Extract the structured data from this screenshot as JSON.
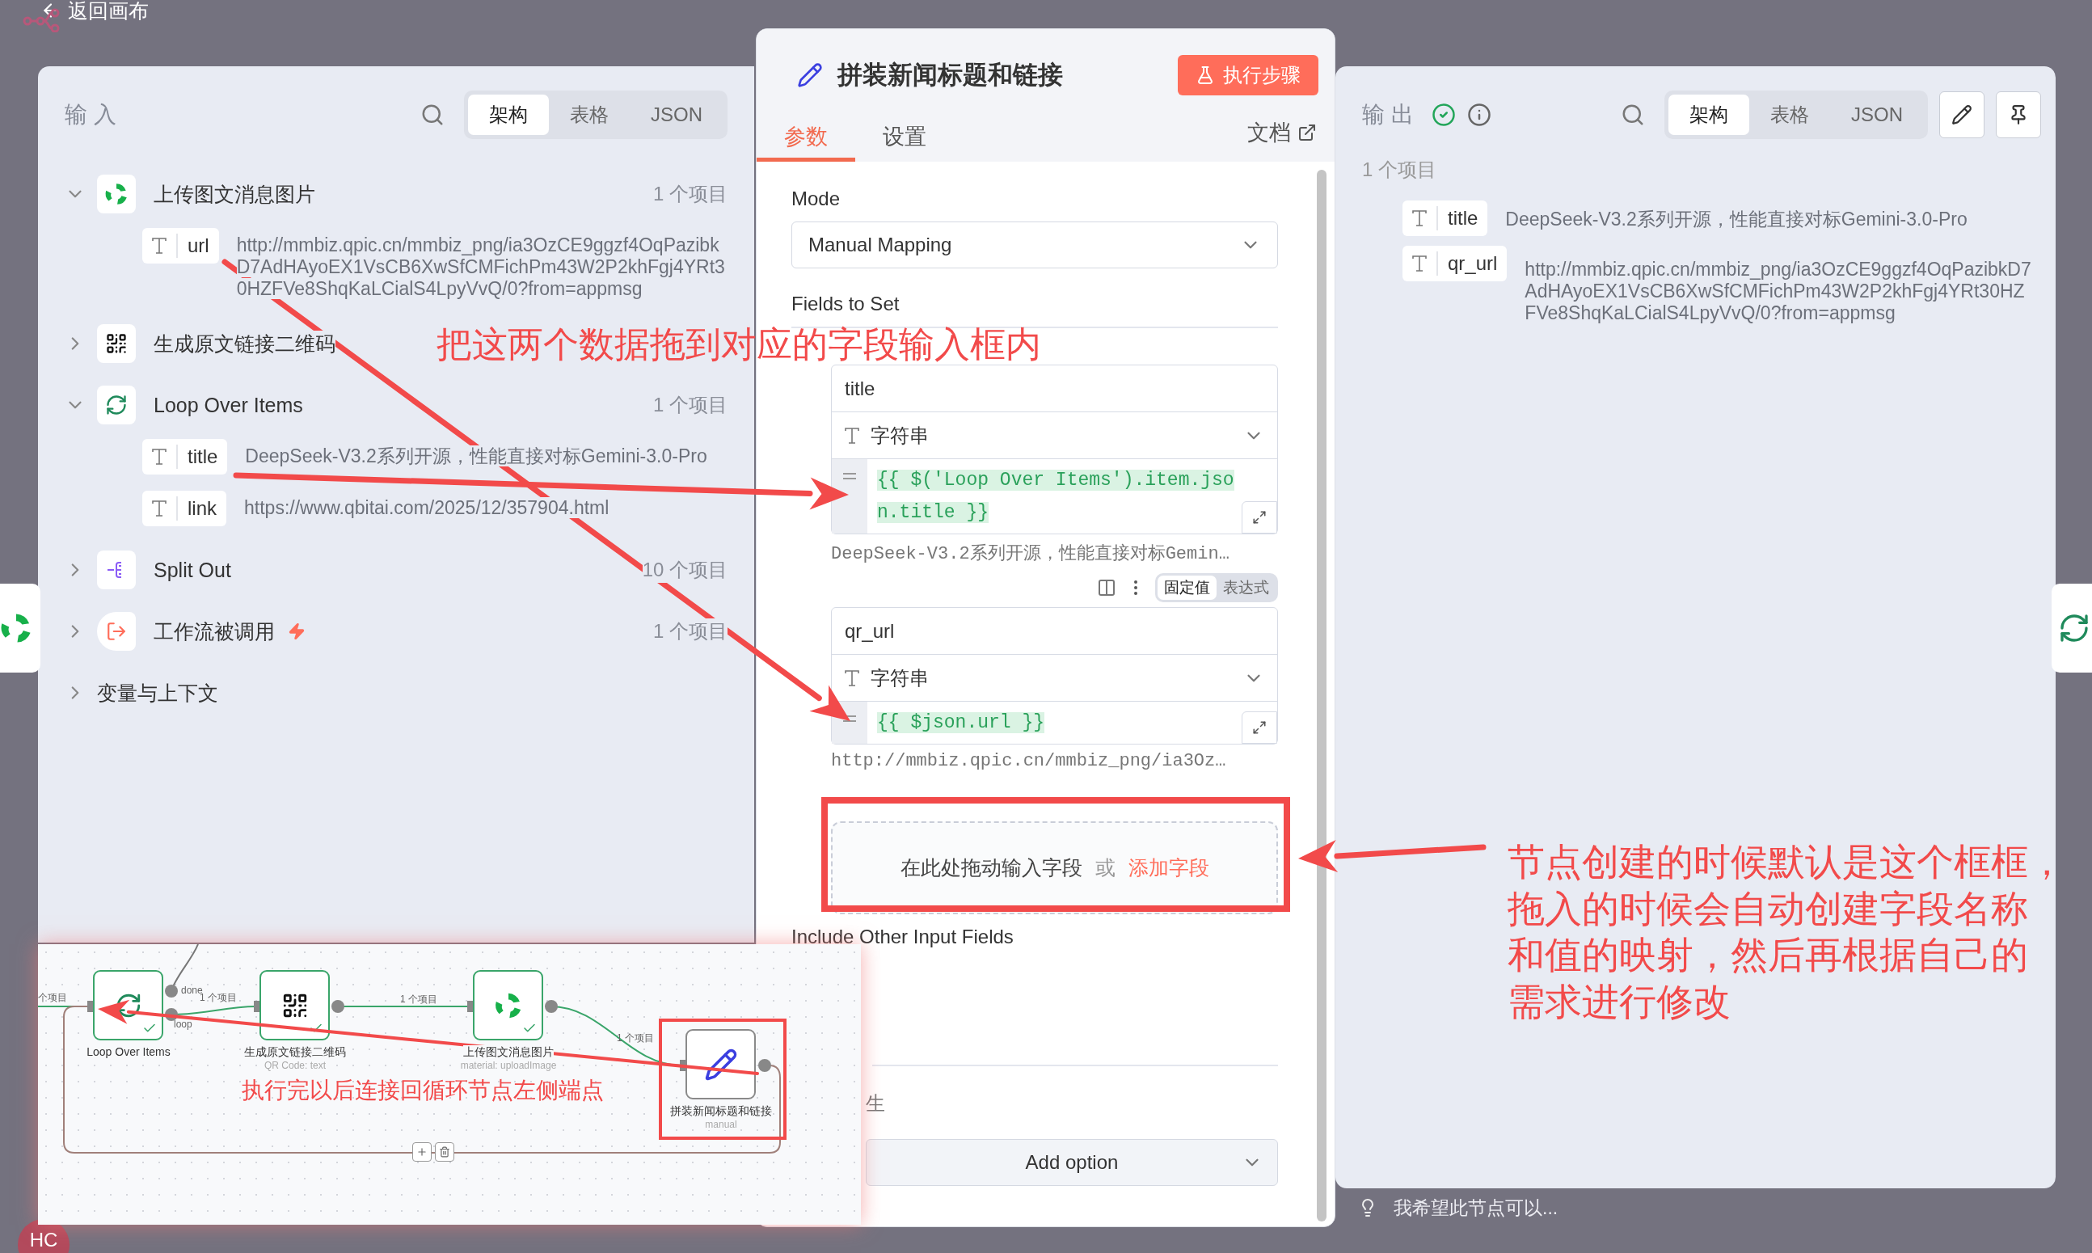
{
  "back_link": {
    "label": "返回画布"
  },
  "input_panel": {
    "title": "输入",
    "view_tabs": [
      {
        "label": "架构",
        "selected": true
      },
      {
        "label": "表格",
        "selected": false
      },
      {
        "label": "JSON",
        "selected": false
      }
    ],
    "nodes": [
      {
        "kind": "upload",
        "name": "上传图文消息图片",
        "count": "1 个项目",
        "expanded": true,
        "fields": [
          {
            "name": "url",
            "value": "http://mmbiz.qpic.cn/mmbiz_png/ia3OzCE9ggzf4OqPazibkD7AdHAyoEX1VsCB6XwSfCMFichPm43W2P2khFgj4YRt30HZFVe8ShqKaLCialS4LpyVvQ/0?from=appmsg"
          }
        ]
      },
      {
        "kind": "qrcode",
        "name": "生成原文链接二维码",
        "expanded": false
      },
      {
        "kind": "loop",
        "name": "Loop Over Items",
        "count": "1 个项目",
        "expanded": true,
        "fields": [
          {
            "name": "title",
            "value": "DeepSeek-V3.2系列开源，性能直接对标Gemini-3.0-Pro"
          },
          {
            "name": "link",
            "value": "https://www.qbitai.com/2025/12/357904.html"
          }
        ]
      },
      {
        "kind": "split",
        "name": "Split Out",
        "count": "10 个项目",
        "expanded": false
      },
      {
        "kind": "trigger",
        "name": "工作流被调用",
        "count": "1 个项目",
        "expanded": false
      }
    ],
    "context": {
      "label": "变量与上下文",
      "expanded": false
    }
  },
  "editor": {
    "title": "拼装新闻标题和链接",
    "run_button": "执行步骤",
    "tabs": [
      {
        "label": "参数",
        "selected": true
      },
      {
        "label": "设置",
        "selected": false
      }
    ],
    "docs_link": "文档",
    "mode": {
      "label": "Mode",
      "value": "Manual Mapping"
    },
    "fields_label": "Fields to Set",
    "fields": [
      {
        "name": "title",
        "type": "字符串",
        "expression": "{{ $('Loop Over Items').item.json.title }}",
        "preview": "DeepSeek-V3.2系列开源，性能直接对标Gemin…"
      },
      {
        "name": "qr_url",
        "type": "字符串",
        "expression": "{{ $json.url }}",
        "preview": "http://mmbiz.qpic.cn/mmbiz_png/ia3Oz…",
        "value_mode": [
          {
            "label": "固定值",
            "selected": true
          },
          {
            "label": "表达式",
            "selected": false
          }
        ]
      }
    ],
    "drop_zone": {
      "hint": "在此处拖动输入字段",
      "or": "或",
      "add_link": "添加字段"
    },
    "include_label": "Include Other Input Fields",
    "options_label": "生",
    "add_option": "Add option"
  },
  "output_panel": {
    "title": "输出",
    "succeeded": true,
    "view_tabs": [
      {
        "label": "架构",
        "selected": true
      },
      {
        "label": "表格",
        "selected": false
      },
      {
        "label": "JSON",
        "selected": false
      }
    ],
    "count": "1 个项目",
    "fields": [
      {
        "name": "title",
        "value": "DeepSeek-V3.2系列开源，性能直接对标Gemini-3.0-Pro"
      },
      {
        "name": "qr_url",
        "value": "http://mmbiz.qpic.cn/mmbiz_png/ia3OzCE9ggzf4OqPazibkD7AdHAyoEX1VsCB6XwSfCMFichPm43W2P2khFgj4YRt30HZFVe8ShqKaLCialS4LpyVvQ/0?from=appmsg"
      }
    ]
  },
  "ai_prompt": {
    "placeholder": "我希望此节点可以..."
  },
  "avatar": {
    "initials": "HC"
  },
  "workflow_inset": {
    "nodes": [
      {
        "kind": "loop",
        "name": "Loop Over Items",
        "executed": true
      },
      {
        "kind": "qrcode",
        "name": "生成原文链接二维码",
        "subtitle": "QR Code: text",
        "executed": true
      },
      {
        "kind": "upload",
        "name": "上传图文消息图片",
        "subtitle": "material: uploadImage",
        "executed": true
      },
      {
        "kind": "set",
        "name": "拼装新闻标题和链接",
        "subtitle": "manual",
        "executed": false
      }
    ],
    "edge_labels": [
      "个项目",
      "done",
      "loop",
      "1 个项目",
      "1 个项目",
      "1 个项目"
    ],
    "note": "执行完以后连接回循环节点左侧端点"
  },
  "annotations": [
    {
      "lines": [
        "把这两个数据拖到对应的字段输入框内"
      ]
    },
    {
      "lines": [
        "节点创建的时候默认是这个框框，",
        "拖入的时候会自动创建字段名称",
        "和值的映射，然后再根据自己的",
        "需求进行修改"
      ]
    }
  ]
}
